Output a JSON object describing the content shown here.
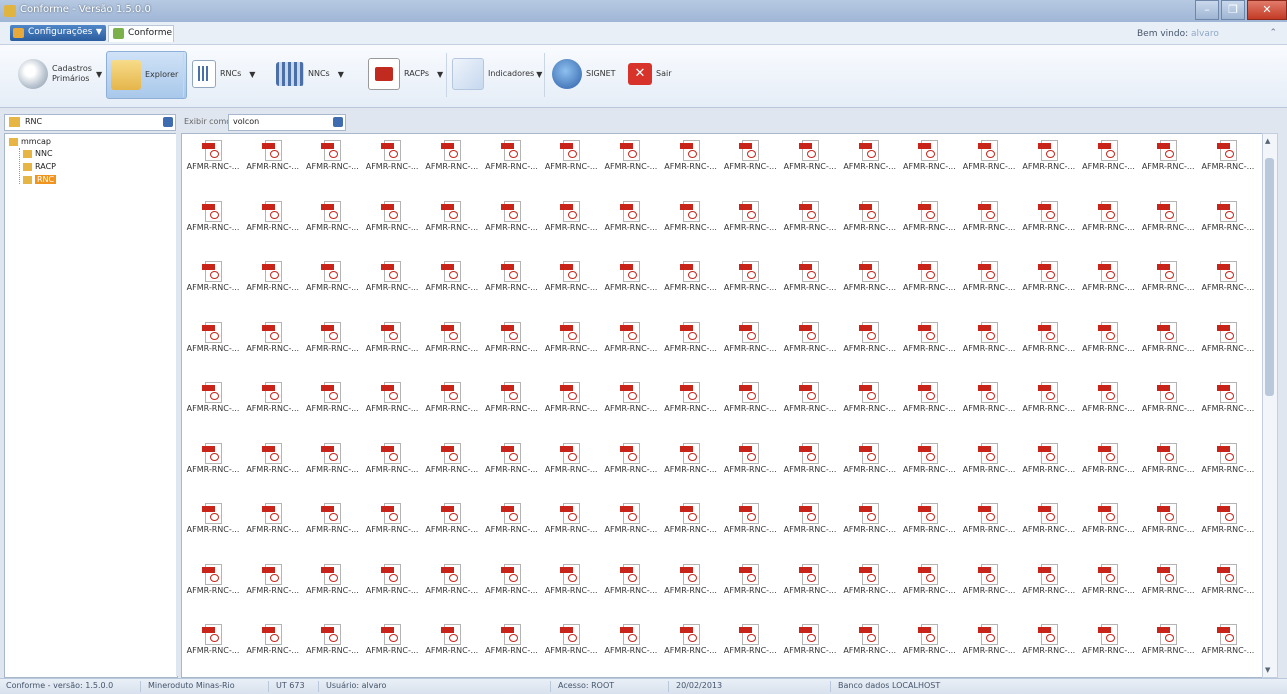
{
  "window": {
    "title": "Conforme - Versão 1.5.0.0"
  },
  "ribbon": {
    "config_label": "Configurações",
    "tab_label": "Conforme",
    "welcome_label": "Bem vindo:",
    "welcome_user": "alvaro"
  },
  "toolbar": {
    "cadastros": "Cadastros Primários",
    "explorer": "Explorer",
    "rncs": "RNCs",
    "nncs": "NNCs",
    "racps": "RACPs",
    "indicadores": "Indicadores",
    "signet": "SIGNET",
    "sair": "Sair"
  },
  "left_combo": {
    "value": "RNC"
  },
  "view": {
    "label": "Exibir como",
    "value": "volcon"
  },
  "tree": {
    "root": "mmcap",
    "children": [
      "NNC",
      "RACP",
      "RNC"
    ],
    "selected": "RNC"
  },
  "files": {
    "name": "AFMR-RNC-...",
    "columns": 18,
    "rows": 9
  },
  "status": {
    "app": "Conforme - versão: 1.5.0.0",
    "company": "Mineroduto Minas-Rio",
    "ut": "UT 673",
    "user": "Usuário: alvaro",
    "access": "Acesso: ROOT",
    "date": "20/02/2013",
    "db": "Banco dados LOCALHOST"
  },
  "colors": {
    "pdf_red": "#c9241a",
    "selection": "#f0941e",
    "accent": "#2b5d9e"
  }
}
